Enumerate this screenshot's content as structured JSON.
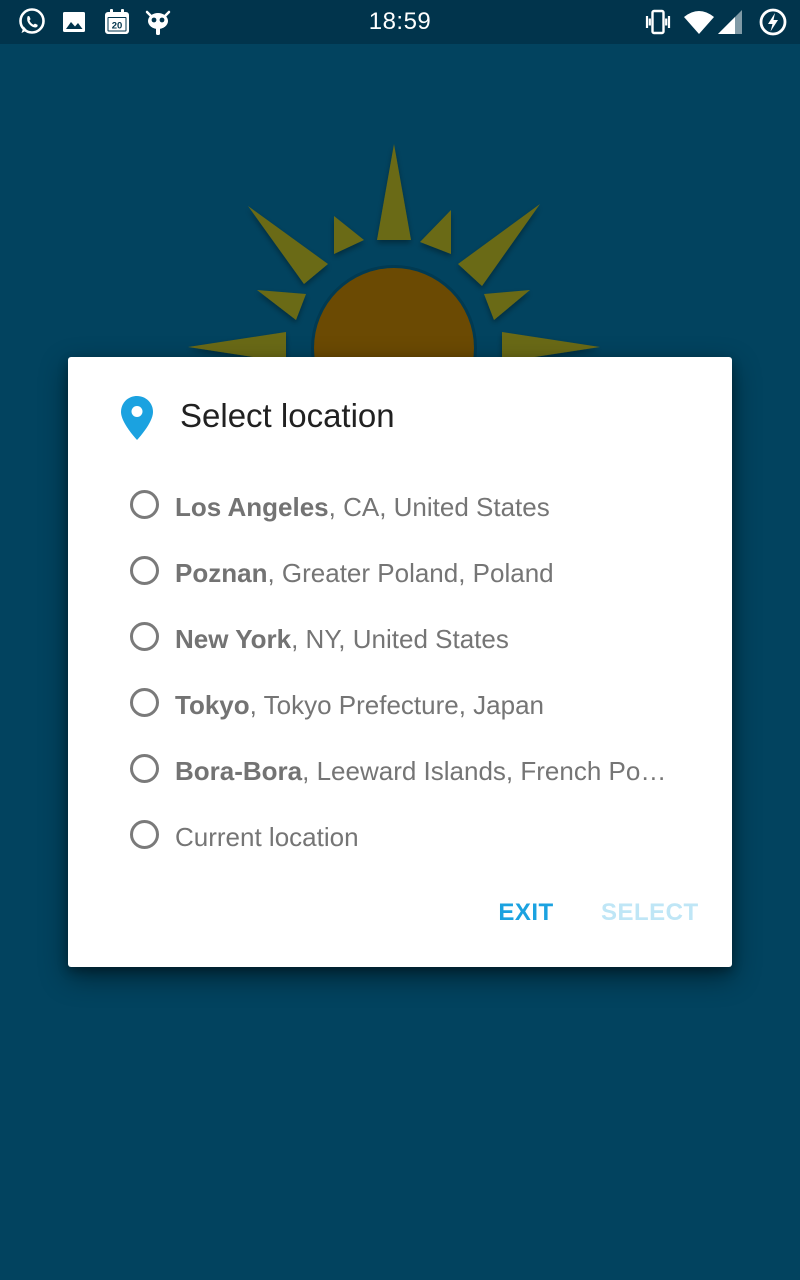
{
  "status_bar": {
    "time": "18:59",
    "left_icons": [
      "whatsapp-icon",
      "image-icon",
      "calendar-icon",
      "android-debug-icon"
    ],
    "calendar_day": "20",
    "right_icons": [
      "vibrate-icon",
      "wifi-icon",
      "cell-signal-icon",
      "battery-charging-icon"
    ]
  },
  "background": {
    "color": "#02435f",
    "illustration": "sun-icon"
  },
  "dialog": {
    "title": "Select location",
    "title_icon": "location-pin-icon",
    "options": [
      {
        "city": "Los Angeles",
        "region": ", CA, United States",
        "selected": false
      },
      {
        "city": "Poznan",
        "region": ", Greater Poland, Poland",
        "selected": false
      },
      {
        "city": "New York",
        "region": ", NY, United States",
        "selected": false
      },
      {
        "city": "Tokyo",
        "region": ", Tokyo Prefecture, Japan",
        "selected": false
      },
      {
        "city": "Bora-Bora",
        "region": ", Leeward Islands, French Po…",
        "selected": false
      },
      {
        "city": "",
        "region": "Current location",
        "selected": false
      }
    ],
    "buttons": {
      "exit": "EXIT",
      "select": "SELECT",
      "select_enabled": false
    }
  },
  "colors": {
    "accent": "#1ba2e0",
    "disabled_accent": "#bfe6f6",
    "status_bar": "#01344c",
    "sun_rays": "#6b6a14",
    "sun_core": "#6b4a03"
  }
}
